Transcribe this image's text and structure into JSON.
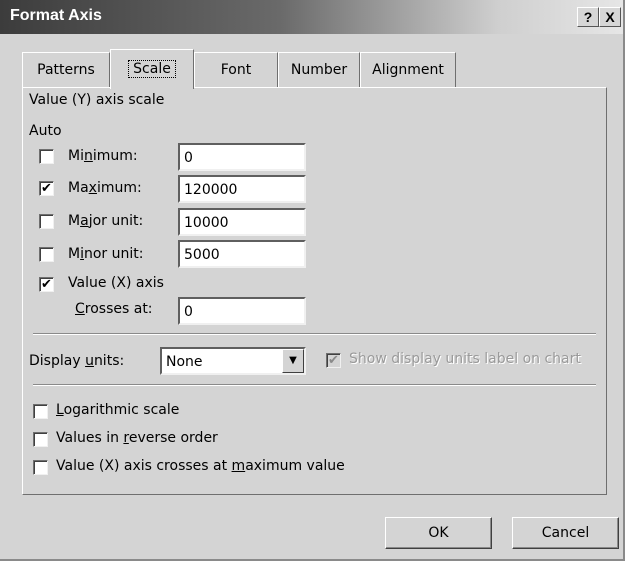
{
  "window": {
    "title": "Format Axis",
    "help_btn": "?",
    "close_btn": "X"
  },
  "tabs": [
    "Patterns",
    "Scale",
    "Font",
    "Number",
    "Alignment"
  ],
  "active_tab": "Scale",
  "scale": {
    "heading": "Value (Y) axis scale",
    "auto_label": "Auto",
    "minimum": {
      "pre": "Mi",
      "acc": "n",
      "post": "imum:",
      "checked": false,
      "value": "0"
    },
    "maximum": {
      "pre": "Ma",
      "acc": "x",
      "post": "imum:",
      "checked": true,
      "value": "120000"
    },
    "major": {
      "pre": "M",
      "acc": "a",
      "post": "jor unit:",
      "checked": false,
      "value": "10000"
    },
    "minor": {
      "pre": "M",
      "acc": "i",
      "post": "nor unit:",
      "checked": false,
      "value": "5000"
    },
    "value_x_axis": {
      "label": "Value (X) axis",
      "checked": true
    },
    "crosses_at": {
      "acc": "C",
      "post": "rosses at:",
      "value": "0"
    },
    "display_units": {
      "pre": "Display ",
      "acc": "u",
      "post": "nits:",
      "value": "None"
    },
    "show_units_label": {
      "label": "Show display units label on chart",
      "checked": true,
      "disabled": true
    },
    "logarithmic": {
      "acc": "L",
      "post": "ogarithmic scale",
      "checked": false
    },
    "reverse_order": {
      "pre": "Values in ",
      "acc": "r",
      "post": "everse order",
      "checked": false
    },
    "crosses_max": {
      "pre": "Value (X) axis crosses at ",
      "acc": "m",
      "post": "aximum value",
      "checked": false
    }
  },
  "buttons": {
    "ok": "OK",
    "cancel": "Cancel"
  },
  "check_mark": "✔"
}
